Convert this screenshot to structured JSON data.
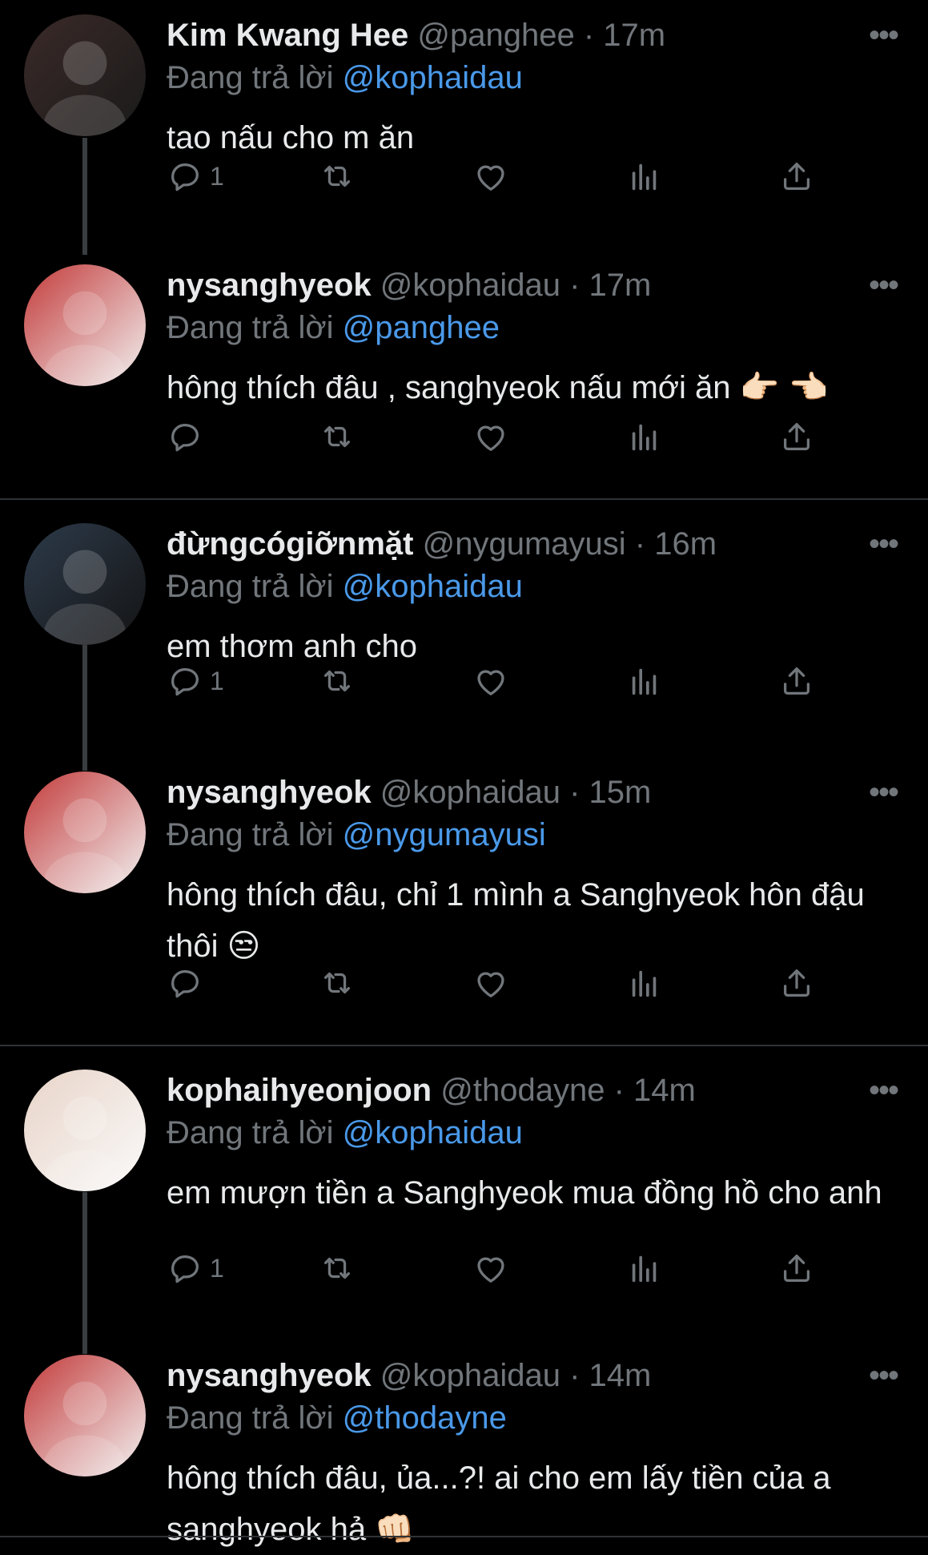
{
  "replying_label": "Đang trả lời",
  "tweets": [
    {
      "name": "Kim Kwang Hee",
      "handle": "@panghee",
      "time": "17m",
      "reply_to": "@kophaidau",
      "text": "tao nấu cho m ăn",
      "reply_count": "1",
      "avatar_colors": [
        "#3a2a28",
        "#1a1a1a"
      ]
    },
    {
      "name": "nysanghyeok",
      "handle": "@kophaidau",
      "time": "17m",
      "reply_to": "@panghee",
      "text": "hông thích đâu , sanghyeok nấu mới ăn 👉🏻 👈🏻",
      "reply_count": "",
      "avatar_colors": [
        "#c33a3a",
        "#f2f2f2"
      ]
    },
    {
      "name": "đừngcógiỡnmặt",
      "handle": "@nygumayusi",
      "time": "16m",
      "reply_to": "@kophaidau",
      "text": "em thơm anh cho",
      "reply_count": "1",
      "avatar_colors": [
        "#2d3a4a",
        "#141414"
      ]
    },
    {
      "name": "nysanghyeok",
      "handle": "@kophaidau",
      "time": "15m",
      "reply_to": "@nygumayusi",
      "text": "hông thích đâu, chỉ 1 mình a Sanghyeok hôn đậu thôi 😒",
      "reply_count": "",
      "avatar_colors": [
        "#c33a3a",
        "#f2f2f2"
      ]
    },
    {
      "name": "kophaihyeonjoon",
      "handle": "@thodayne",
      "time": "14m",
      "reply_to": "@kophaidau",
      "text": "em mượn tiền a Sanghyeok mua đồng hồ cho anh",
      "reply_count": "1",
      "avatar_colors": [
        "#e8d4c8",
        "#fafafa"
      ]
    },
    {
      "name": "nysanghyeok",
      "handle": "@kophaidau",
      "time": "14m",
      "reply_to": "@thodayne",
      "text": "hông thích đâu, ủa...?! ai cho em lấy tiền của a sanghyeok hả 👊🏻",
      "reply_count": "",
      "avatar_colors": [
        "#c33a3a",
        "#f2f2f2"
      ]
    }
  ],
  "icons": {
    "reply": "reply-icon",
    "retweet": "retweet-icon",
    "like": "heart-icon",
    "views": "views-icon",
    "share": "share-icon",
    "more": "more-icon"
  },
  "colors": {
    "background": "#000000",
    "text": "#e7e9ea",
    "muted": "#71767b",
    "link": "#4a99e9",
    "divider": "#2f3336"
  }
}
